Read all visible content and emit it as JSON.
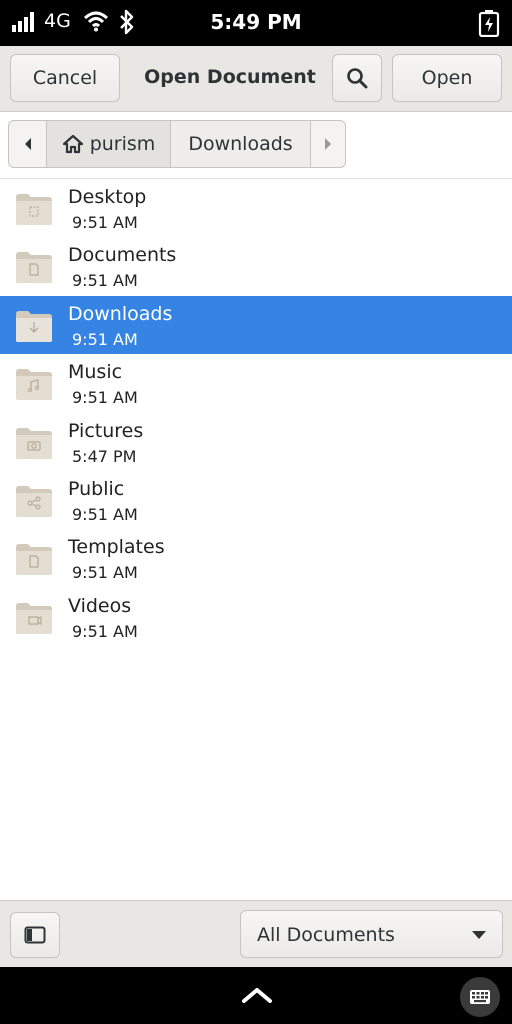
{
  "status": {
    "network": "4G",
    "time": "5:49 PM",
    "icons": [
      "signal-icon",
      "wifi-icon",
      "bluetooth-icon",
      "battery-charging-icon"
    ]
  },
  "header": {
    "cancel_label": "Cancel",
    "title": "Open Document",
    "search_icon": "search-icon",
    "open_label": "Open"
  },
  "pathbar": {
    "home_label": "purism",
    "current_label": "Downloads"
  },
  "files": [
    {
      "name": "Desktop",
      "time": "9:51 AM",
      "icon": "desktop-folder-icon"
    },
    {
      "name": "Documents",
      "time": "9:51 AM",
      "icon": "documents-folder-icon"
    },
    {
      "name": "Downloads",
      "time": "9:51 AM",
      "icon": "downloads-folder-icon",
      "selected": true
    },
    {
      "name": "Music",
      "time": "9:51 AM",
      "icon": "music-folder-icon"
    },
    {
      "name": "Pictures",
      "time": "5:47 PM",
      "icon": "pictures-folder-icon"
    },
    {
      "name": "Public",
      "time": "9:51 AM",
      "icon": "public-folder-icon"
    },
    {
      "name": "Templates",
      "time": "9:51 AM",
      "icon": "templates-folder-icon"
    },
    {
      "name": "Videos",
      "time": "9:51 AM",
      "icon": "videos-folder-icon"
    }
  ],
  "footer": {
    "filter_label": "All Documents"
  },
  "colors": {
    "accent": "#3584e4",
    "folder": "#d9d2c6",
    "headerbar": "#e9e7e4"
  }
}
